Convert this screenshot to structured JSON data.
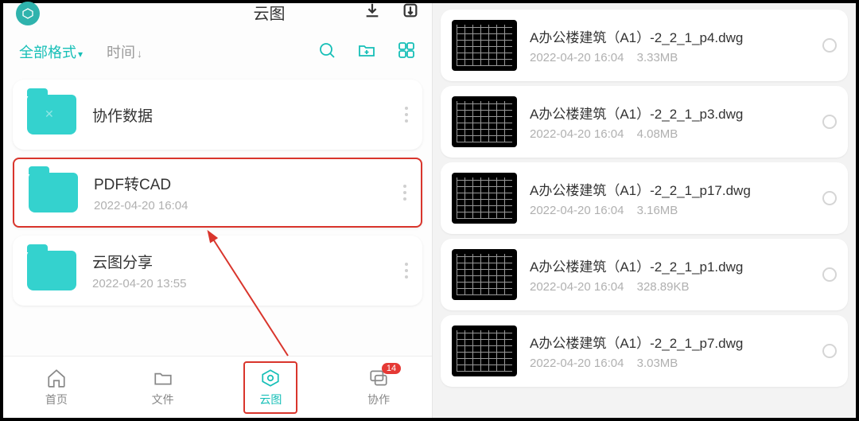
{
  "header": {
    "title": "云图"
  },
  "filter": {
    "format_label": "全部格式",
    "time_label": "时间"
  },
  "folders": [
    {
      "name": "协作数据",
      "date": ""
    },
    {
      "name": "PDF转CAD",
      "date": "2022-04-20 16:04"
    },
    {
      "name": "云图分享",
      "date": "2022-04-20 13:55"
    }
  ],
  "nav": {
    "home": "首页",
    "files": "文件",
    "cloud": "云图",
    "collab": "协作",
    "badge": "14"
  },
  "files": [
    {
      "name": "A办公楼建筑（A1）-2_2_1_p4.dwg",
      "date": "2022-04-20 16:04",
      "size": "3.33MB"
    },
    {
      "name": "A办公楼建筑（A1）-2_2_1_p3.dwg",
      "date": "2022-04-20 16:04",
      "size": "4.08MB"
    },
    {
      "name": "A办公楼建筑（A1）-2_2_1_p17.dwg",
      "date": "2022-04-20 16:04",
      "size": "3.16MB"
    },
    {
      "name": "A办公楼建筑（A1）-2_2_1_p1.dwg",
      "date": "2022-04-20 16:04",
      "size": "328.89KB"
    },
    {
      "name": "A办公楼建筑（A1）-2_2_1_p7.dwg",
      "date": "2022-04-20 16:04",
      "size": "3.03MB"
    }
  ]
}
